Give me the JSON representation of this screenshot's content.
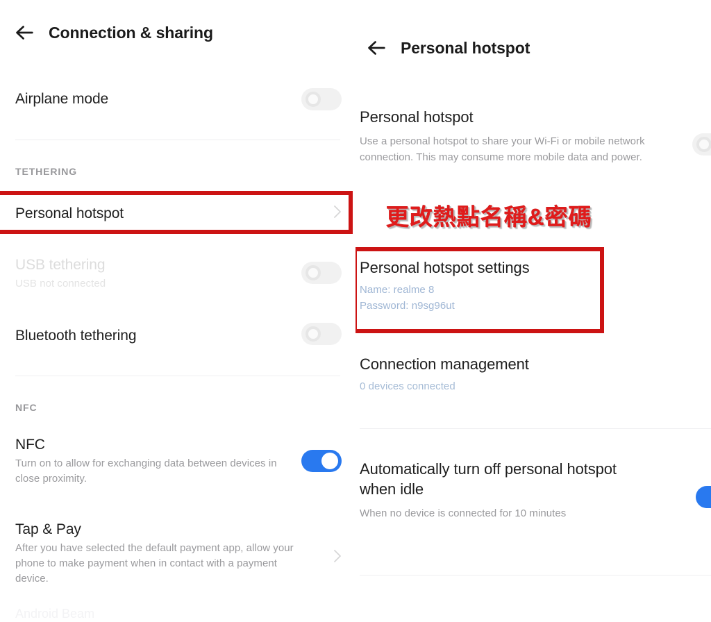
{
  "left_panel": {
    "app_bar": {
      "back_icon": "arrow-left-icon",
      "title": "Connection & sharing"
    },
    "rows": [
      {
        "title": "Airplane mode",
        "toggle": "off"
      }
    ],
    "section_tethering": "TETHERING",
    "personal_hotspot": {
      "title": "Personal hotspot",
      "chevron": "chevron-right-icon",
      "highlighted": true
    },
    "usb_tethering": {
      "title": "USB tethering",
      "subtitle": "USB not connected",
      "toggle": "off",
      "disabled": true
    },
    "bluetooth_tethering": {
      "title": "Bluetooth tethering",
      "toggle": "off"
    },
    "section_nfc": "NFC",
    "nfc": {
      "title": "NFC",
      "subtitle": "Turn on to allow for exchanging data between devices in close proximity.",
      "toggle": "on"
    },
    "tap_and_pay": {
      "title": "Tap & Pay",
      "subtitle": "After you have selected the default payment app, allow your phone to make payment when in contact with a payment device.",
      "chevron": "chevron-right-icon"
    }
  },
  "right_panel": {
    "app_bar": {
      "back_icon": "arrow-left-icon",
      "title": "Personal hotspot"
    },
    "personal_hotspot": {
      "title": "Personal hotspot",
      "subtitle": "Use a personal hotspot to share your Wi-Fi or mobile network connection. This may consume more mobile data and power.",
      "toggle": "off"
    },
    "hotspot_settings": {
      "title": "Personal hotspot settings",
      "name_line": "Name: realme 8",
      "password_line": "Password: n9sg96ut",
      "highlighted": true
    },
    "connection_management": {
      "title": "Connection management",
      "subtitle": "0 devices connected"
    },
    "auto_off": {
      "title": "Automatically turn off personal hotspot when idle",
      "subtitle": "When no device is connected for 10 minutes",
      "toggle": "on"
    }
  },
  "annotation": {
    "text": "更改熱點名稱&密碼"
  },
  "ghost": {
    "text": "Android Beam"
  },
  "colors": {
    "accent_blue": "#2979ef",
    "highlight_red": "#cc1313",
    "annotation_red": "#e01b1b",
    "title_text": "#1e1e1e",
    "sub_text": "#9a9a9d",
    "link_blue_text": "#9fb6d4",
    "divider": "#eeeef0",
    "toggle_off": "#e8e8e8"
  }
}
